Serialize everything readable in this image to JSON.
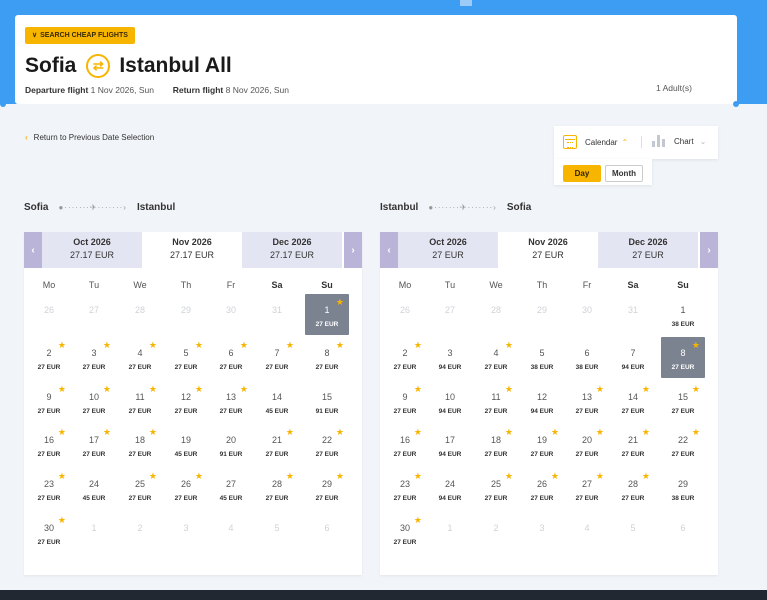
{
  "header": {
    "search_button": "SEARCH CHEAP FLIGHTS",
    "origin": "Sofia",
    "destination": "Istanbul All",
    "departure_label": "Departure flight",
    "departure_value": "1 Nov 2026, Sun",
    "return_label": "Return flight",
    "return_value": "8 Nov 2026, Sun",
    "passengers": "1 Adult(s)"
  },
  "back_link": "Return to Previous Date Selection",
  "view": {
    "calendar_label": "Calendar",
    "chart_label": "Chart",
    "day_label": "Day",
    "month_label": "Month"
  },
  "weekdays": [
    "Mo",
    "Tu",
    "We",
    "Th",
    "Fr",
    "Sa",
    "Su"
  ],
  "calendars": [
    {
      "from": "Sofia",
      "to": "Istanbul",
      "months": [
        {
          "name": "Oct 2026",
          "price": "27.17 EUR"
        },
        {
          "name": "Nov 2026",
          "price": "27.17 EUR"
        },
        {
          "name": "Dec 2026",
          "price": "27.17 EUR"
        }
      ],
      "days": [
        {
          "d": "26",
          "p": "",
          "star": false,
          "muted": true,
          "sel": false
        },
        {
          "d": "27",
          "p": "",
          "star": false,
          "muted": true,
          "sel": false
        },
        {
          "d": "28",
          "p": "",
          "star": false,
          "muted": true,
          "sel": false
        },
        {
          "d": "29",
          "p": "",
          "star": false,
          "muted": true,
          "sel": false
        },
        {
          "d": "30",
          "p": "",
          "star": false,
          "muted": true,
          "sel": false
        },
        {
          "d": "31",
          "p": "",
          "star": false,
          "muted": true,
          "sel": false
        },
        {
          "d": "1",
          "p": "27 EUR",
          "star": true,
          "muted": false,
          "sel": true
        },
        {
          "d": "2",
          "p": "27 EUR",
          "star": true,
          "muted": false,
          "sel": false
        },
        {
          "d": "3",
          "p": "27 EUR",
          "star": true,
          "muted": false,
          "sel": false
        },
        {
          "d": "4",
          "p": "27 EUR",
          "star": true,
          "muted": false,
          "sel": false
        },
        {
          "d": "5",
          "p": "27 EUR",
          "star": true,
          "muted": false,
          "sel": false
        },
        {
          "d": "6",
          "p": "27 EUR",
          "star": true,
          "muted": false,
          "sel": false
        },
        {
          "d": "7",
          "p": "27 EUR",
          "star": true,
          "muted": false,
          "sel": false
        },
        {
          "d": "8",
          "p": "27 EUR",
          "star": true,
          "muted": false,
          "sel": false
        },
        {
          "d": "9",
          "p": "27 EUR",
          "star": true,
          "muted": false,
          "sel": false
        },
        {
          "d": "10",
          "p": "27 EUR",
          "star": true,
          "muted": false,
          "sel": false
        },
        {
          "d": "11",
          "p": "27 EUR",
          "star": true,
          "muted": false,
          "sel": false
        },
        {
          "d": "12",
          "p": "27 EUR",
          "star": true,
          "muted": false,
          "sel": false
        },
        {
          "d": "13",
          "p": "27 EUR",
          "star": true,
          "muted": false,
          "sel": false
        },
        {
          "d": "14",
          "p": "45 EUR",
          "star": false,
          "muted": false,
          "sel": false
        },
        {
          "d": "15",
          "p": "91 EUR",
          "star": false,
          "muted": false,
          "sel": false
        },
        {
          "d": "16",
          "p": "27 EUR",
          "star": true,
          "muted": false,
          "sel": false
        },
        {
          "d": "17",
          "p": "27 EUR",
          "star": true,
          "muted": false,
          "sel": false
        },
        {
          "d": "18",
          "p": "27 EUR",
          "star": true,
          "muted": false,
          "sel": false
        },
        {
          "d": "19",
          "p": "45 EUR",
          "star": false,
          "muted": false,
          "sel": false
        },
        {
          "d": "20",
          "p": "91 EUR",
          "star": false,
          "muted": false,
          "sel": false
        },
        {
          "d": "21",
          "p": "27 EUR",
          "star": true,
          "muted": false,
          "sel": false
        },
        {
          "d": "22",
          "p": "27 EUR",
          "star": true,
          "muted": false,
          "sel": false
        },
        {
          "d": "23",
          "p": "27 EUR",
          "star": true,
          "muted": false,
          "sel": false
        },
        {
          "d": "24",
          "p": "45 EUR",
          "star": false,
          "muted": false,
          "sel": false
        },
        {
          "d": "25",
          "p": "27 EUR",
          "star": true,
          "muted": false,
          "sel": false
        },
        {
          "d": "26",
          "p": "27 EUR",
          "star": true,
          "muted": false,
          "sel": false
        },
        {
          "d": "27",
          "p": "45 EUR",
          "star": false,
          "muted": false,
          "sel": false
        },
        {
          "d": "28",
          "p": "27 EUR",
          "star": true,
          "muted": false,
          "sel": false
        },
        {
          "d": "29",
          "p": "27 EUR",
          "star": true,
          "muted": false,
          "sel": false
        },
        {
          "d": "30",
          "p": "27 EUR",
          "star": true,
          "muted": false,
          "sel": false
        },
        {
          "d": "1",
          "p": "",
          "star": false,
          "muted": true,
          "sel": false
        },
        {
          "d": "2",
          "p": "",
          "star": false,
          "muted": true,
          "sel": false
        },
        {
          "d": "3",
          "p": "",
          "star": false,
          "muted": true,
          "sel": false
        },
        {
          "d": "4",
          "p": "",
          "star": false,
          "muted": true,
          "sel": false
        },
        {
          "d": "5",
          "p": "",
          "star": false,
          "muted": true,
          "sel": false
        },
        {
          "d": "6",
          "p": "",
          "star": false,
          "muted": true,
          "sel": false
        }
      ]
    },
    {
      "from": "Istanbul",
      "to": "Sofia",
      "months": [
        {
          "name": "Oct 2026",
          "price": "27 EUR"
        },
        {
          "name": "Nov 2026",
          "price": "27 EUR"
        },
        {
          "name": "Dec 2026",
          "price": "27 EUR"
        }
      ],
      "days": [
        {
          "d": "26",
          "p": "",
          "star": false,
          "muted": true,
          "sel": false
        },
        {
          "d": "27",
          "p": "",
          "star": false,
          "muted": true,
          "sel": false
        },
        {
          "d": "28",
          "p": "",
          "star": false,
          "muted": true,
          "sel": false
        },
        {
          "d": "29",
          "p": "",
          "star": false,
          "muted": true,
          "sel": false
        },
        {
          "d": "30",
          "p": "",
          "star": false,
          "muted": true,
          "sel": false
        },
        {
          "d": "31",
          "p": "",
          "star": false,
          "muted": true,
          "sel": false
        },
        {
          "d": "1",
          "p": "38 EUR",
          "star": false,
          "muted": false,
          "sel": false
        },
        {
          "d": "2",
          "p": "27 EUR",
          "star": true,
          "muted": false,
          "sel": false
        },
        {
          "d": "3",
          "p": "94 EUR",
          "star": false,
          "muted": false,
          "sel": false
        },
        {
          "d": "4",
          "p": "27 EUR",
          "star": true,
          "muted": false,
          "sel": false
        },
        {
          "d": "5",
          "p": "38 EUR",
          "star": false,
          "muted": false,
          "sel": false
        },
        {
          "d": "6",
          "p": "38 EUR",
          "star": false,
          "muted": false,
          "sel": false
        },
        {
          "d": "7",
          "p": "94 EUR",
          "star": false,
          "muted": false,
          "sel": false
        },
        {
          "d": "8",
          "p": "27 EUR",
          "star": true,
          "muted": false,
          "sel": true
        },
        {
          "d": "9",
          "p": "27 EUR",
          "star": true,
          "muted": false,
          "sel": false
        },
        {
          "d": "10",
          "p": "94 EUR",
          "star": false,
          "muted": false,
          "sel": false
        },
        {
          "d": "11",
          "p": "27 EUR",
          "star": true,
          "muted": false,
          "sel": false
        },
        {
          "d": "12",
          "p": "94 EUR",
          "star": false,
          "muted": false,
          "sel": false
        },
        {
          "d": "13",
          "p": "27 EUR",
          "star": true,
          "muted": false,
          "sel": false
        },
        {
          "d": "14",
          "p": "27 EUR",
          "star": true,
          "muted": false,
          "sel": false
        },
        {
          "d": "15",
          "p": "27 EUR",
          "star": true,
          "muted": false,
          "sel": false
        },
        {
          "d": "16",
          "p": "27 EUR",
          "star": true,
          "muted": false,
          "sel": false
        },
        {
          "d": "17",
          "p": "94 EUR",
          "star": false,
          "muted": false,
          "sel": false
        },
        {
          "d": "18",
          "p": "27 EUR",
          "star": true,
          "muted": false,
          "sel": false
        },
        {
          "d": "19",
          "p": "27 EUR",
          "star": true,
          "muted": false,
          "sel": false
        },
        {
          "d": "20",
          "p": "27 EUR",
          "star": true,
          "muted": false,
          "sel": false
        },
        {
          "d": "21",
          "p": "27 EUR",
          "star": true,
          "muted": false,
          "sel": false
        },
        {
          "d": "22",
          "p": "27 EUR",
          "star": true,
          "muted": false,
          "sel": false
        },
        {
          "d": "23",
          "p": "27 EUR",
          "star": true,
          "muted": false,
          "sel": false
        },
        {
          "d": "24",
          "p": "94 EUR",
          "star": false,
          "muted": false,
          "sel": false
        },
        {
          "d": "25",
          "p": "27 EUR",
          "star": true,
          "muted": false,
          "sel": false
        },
        {
          "d": "26",
          "p": "27 EUR",
          "star": true,
          "muted": false,
          "sel": false
        },
        {
          "d": "27",
          "p": "27 EUR",
          "star": true,
          "muted": false,
          "sel": false
        },
        {
          "d": "28",
          "p": "27 EUR",
          "star": true,
          "muted": false,
          "sel": false
        },
        {
          "d": "29",
          "p": "38 EUR",
          "star": false,
          "muted": false,
          "sel": false
        },
        {
          "d": "30",
          "p": "27 EUR",
          "star": true,
          "muted": false,
          "sel": false
        },
        {
          "d": "1",
          "p": "",
          "star": false,
          "muted": true,
          "sel": false
        },
        {
          "d": "2",
          "p": "",
          "star": false,
          "muted": true,
          "sel": false
        },
        {
          "d": "3",
          "p": "",
          "star": false,
          "muted": true,
          "sel": false
        },
        {
          "d": "4",
          "p": "",
          "star": false,
          "muted": true,
          "sel": false
        },
        {
          "d": "5",
          "p": "",
          "star": false,
          "muted": true,
          "sel": false
        },
        {
          "d": "6",
          "p": "",
          "star": false,
          "muted": true,
          "sel": false
        }
      ]
    }
  ]
}
